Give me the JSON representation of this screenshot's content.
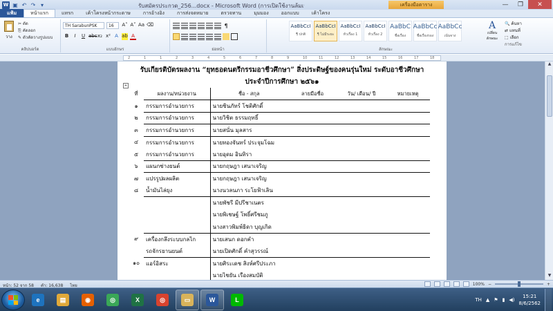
{
  "window": {
    "title": "รับสมัครประกวด_256...docx - Microsoft Word (การเปิดใช้งานล้มเหลว)",
    "context_tab": "เครื่องมือตาราง",
    "minimize": "—",
    "maximize": "❐",
    "close": "✕"
  },
  "ribbon_tabs": [
    "แฟ้ม",
    "หน้าแรก",
    "แทรก",
    "เค้าโครงหน้ากระดาษ",
    "การอ้างอิง",
    "การส่งจดหมาย",
    "ตรวจทาน",
    "มุมมอง",
    "ออกแบบ",
    "เค้าโครง"
  ],
  "ribbon": {
    "paste_label": "วาง",
    "clipboard_items": [
      "ตัด",
      "คัดลอก",
      "ตัวคัดวางรูปแบบ"
    ],
    "clipboard_group": "คลิปบอร์ด",
    "font_name": "TH SarabunPSK",
    "font_size": "16",
    "font_group": "แบบอักษร",
    "paragraph_group": "ย่อหน้า",
    "styles": [
      {
        "sample": "AaBbCcI",
        "name": "¶ ปกติ",
        "selected": false
      },
      {
        "sample": "AaBbCcI",
        "name": "¶ ไม่มีระยะ",
        "selected": true
      },
      {
        "sample": "AaBbCcI",
        "name": "หัวเรื่อง 1",
        "selected": false
      },
      {
        "sample": "AaBbCcI",
        "name": "หัวเรื่อง 2",
        "selected": false
      },
      {
        "sample": "AaBbC",
        "name": "ชื่อเรื่อง",
        "selected": false
      },
      {
        "sample": "AaBbCc",
        "name": "ชื่อเรื่องรอง",
        "selected": false
      },
      {
        "sample": "AaBbCc",
        "name": "เน้นจาง",
        "selected": false
      }
    ],
    "styles_group": "ลักษณะ",
    "change_styles": "เปลี่ยนลักษณะ",
    "editing_items": [
      "ค้นหา",
      "แทนที่",
      "เลือก"
    ],
    "editing_group": "การแก้ไข"
  },
  "ruler": {
    "numbers": [
      "2",
      "1",
      "1",
      "2",
      "3",
      "4",
      "5",
      "6",
      "7",
      "8",
      "9",
      "10",
      "11",
      "12",
      "13",
      "14",
      "15",
      "16",
      "17",
      "18"
    ]
  },
  "document": {
    "title_line1": "รับเกียรติบัตรผลงาน “ยุทธอดนตรีกรรมอาชีวศึกษา” สิ่งประดิษฐ์ของคนรุ่นใหม่ ระดับอาชีวศึกษา",
    "title_line2": "ประจำปีการศึกษา ๒๕๖๑",
    "headers": [
      "ที่",
      "ผลงาน/หน่วยงาน",
      "ชื่อ - สกุล",
      "ลายมือชื่อ",
      "วัน/ เดือน/ ปี",
      "หมายเหตุ"
    ],
    "rows": [
      {
        "no": "๑",
        "dept": "กรรมการอำนวยการ",
        "name": "นายชินภัทร์ โชติศักดิ์"
      },
      {
        "no": "๒",
        "dept": "กรรมการอำนวยการ",
        "name": "นายวิชิต ธรรมฤทธิ์"
      },
      {
        "no": "๓",
        "dept": "กรรมการอำนวยการ",
        "name": "นายสนั่น มุลสาร"
      },
      {
        "no": "๔",
        "dept": "กรรมการอำนวยการ",
        "name": "นายทองจันทร์ ประจุมโฉม"
      },
      {
        "no": "๕",
        "dept": "กรรมการอำนวยการ",
        "name": "นายอุดม อินทิรา"
      },
      {
        "no": "๖",
        "dept": "แผนกช่างยนต์",
        "name": "นายกฤษฎา เสนาเจริญ"
      },
      {
        "no": "๗",
        "dept": "แปรรูปผลผลิต",
        "name": "นายกฤษฎา เสนาเจริญ"
      },
      {
        "no": "๘",
        "dept": "น้ำมันไล่ยุง",
        "name": "นางนวลนภา ระโยฟ้าเลิน"
      },
      {
        "no": "",
        "dept": "",
        "name": "นายพัชรี มีปรีชาเนตร"
      },
      {
        "no": "",
        "dept": "",
        "name": "นายพิเชษฐ์ โพธิ์ศรีชมภู"
      },
      {
        "no": "",
        "dept": "",
        "name": "นางสาวพิมพ์ธิดา บุญเกิด"
      },
      {
        "no": "๙",
        "dept": "เครื่องกลึงระบบกลไก",
        "name": "นายเสนก ดอกคำ"
      },
      {
        "no": "",
        "dept": "รถจักรยานยนต์",
        "name": "นายเปิดศักดิ์ คำสุวรรณ์"
      },
      {
        "no": "๑๐",
        "dept": "แอร์อิสระ",
        "name": "นายศิระเดช สิงห์ศรีประภา"
      },
      {
        "no": "",
        "dept": "",
        "name": "นายไชยัน เรืองสมบัติ"
      }
    ]
  },
  "statusbar": {
    "page": "หน้า: 52 จาก 58",
    "words": "คำ: 16,638",
    "lang": "ไทย",
    "zoom": "100%",
    "zoom_fraction": 0.5
  },
  "taskbar": {
    "items": [
      {
        "icon": "ie-icon",
        "color": "#1e73be",
        "glyph": "e",
        "open": false
      },
      {
        "icon": "explorer-icon",
        "color": "#e0a93a",
        "glyph": "▤",
        "open": false
      },
      {
        "icon": "firefox-icon",
        "color": "#e66000",
        "glyph": "◉",
        "open": false
      },
      {
        "icon": "chrome-icon",
        "color": "#3aa757",
        "glyph": "◎",
        "open": false
      },
      {
        "icon": "excel-icon",
        "color": "#1f7244",
        "glyph": "X",
        "open": false
      },
      {
        "icon": "chrome-icon",
        "color": "#d8432e",
        "glyph": "◎",
        "open": false
      },
      {
        "icon": "folder-icon",
        "color": "#d9b35a",
        "glyph": "▭",
        "open": true
      },
      {
        "icon": "word-icon",
        "color": "#2b579a",
        "glyph": "W",
        "open": true
      },
      {
        "icon": "line-icon",
        "color": "#00b900",
        "glyph": "L",
        "open": false
      }
    ],
    "lang": "TH",
    "time": "15:21",
    "date": "8/6/2562"
  }
}
